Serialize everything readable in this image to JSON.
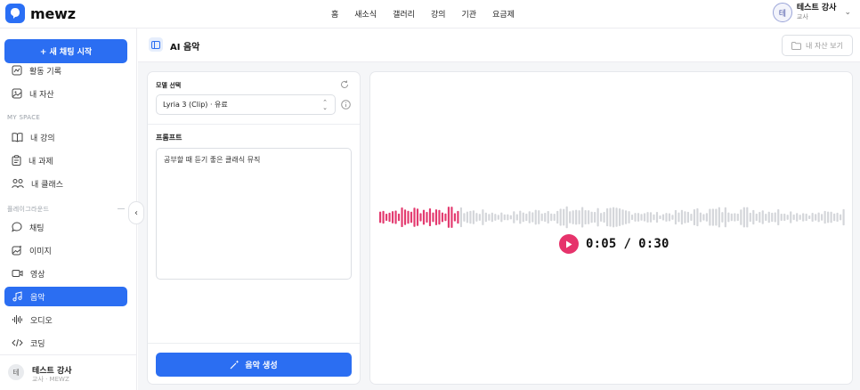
{
  "app": {
    "brand": "mewz"
  },
  "nav": {
    "items": [
      "홈",
      "새소식",
      "갤러리",
      "강의",
      "기관",
      "요금제"
    ]
  },
  "profile": {
    "avatar_letter": "테",
    "name": "테스트 강사",
    "role": "교사"
  },
  "sidebar": {
    "new_chat_label": "+ 새 채팅 시작",
    "top_items": [
      {
        "label": "활동 기록",
        "icon": "activity-chart-icon"
      },
      {
        "label": "내 자산",
        "icon": "image-icon"
      }
    ],
    "myspace_title": "MY SPACE",
    "myspace_items": [
      {
        "label": "내 강의",
        "icon": "book-icon"
      },
      {
        "label": "내 과제",
        "icon": "clipboard-icon"
      },
      {
        "label": "내 클래스",
        "icon": "users-icon"
      }
    ],
    "playground_title": "플레이그라운드",
    "playground_items": [
      {
        "label": "채팅",
        "icon": "chat-icon"
      },
      {
        "label": "이미지",
        "icon": "image-sparkle-icon"
      },
      {
        "label": "영상",
        "icon": "video-icon"
      },
      {
        "label": "음악",
        "icon": "music-icon",
        "active": true
      },
      {
        "label": "오디오",
        "icon": "audio-wave-icon"
      },
      {
        "label": "코딩",
        "icon": "code-icon"
      }
    ],
    "footer": {
      "avatar_letter": "테",
      "name": "테스트 강사",
      "role": "교사 · MEWZ"
    }
  },
  "page": {
    "title": "AI 음악",
    "view_button": "내 자산 보기"
  },
  "form": {
    "model_label": "모델 선택",
    "model_selected": "Lyria 3 (Clip) · 유료",
    "prompt_label": "프롬프트",
    "prompt_value": "공부할 때 듣기 좋은 클래식 뮤직",
    "generate_label": "음악 생성"
  },
  "player": {
    "current_time": "0:05",
    "separator": "/",
    "total_time": "0:30",
    "progress": 0.1667,
    "played_color": "#e33a6f",
    "unplayed_color": "#d4d6da"
  },
  "colors": {
    "accent": "#2b6ef2",
    "play": "#e6336b"
  }
}
